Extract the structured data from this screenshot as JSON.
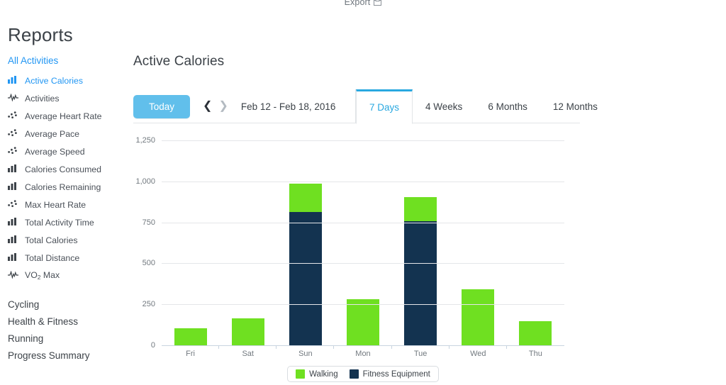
{
  "header": {
    "export_label": "Export",
    "export_icon": "export-icon",
    "page_title": "Reports"
  },
  "sidebar": {
    "group_label": "All Activities",
    "items": [
      {
        "label": "Active Calories",
        "icon": "bar-chart-icon",
        "active": true
      },
      {
        "label": "Activities",
        "icon": "pulse-line-icon",
        "active": false
      },
      {
        "label": "Average Heart Rate",
        "icon": "scatter-dots-icon",
        "active": false
      },
      {
        "label": "Average Pace",
        "icon": "scatter-dots-icon",
        "active": false
      },
      {
        "label": "Average Speed",
        "icon": "scatter-dots-icon",
        "active": false
      },
      {
        "label": "Calories Consumed",
        "icon": "bar-chart-icon",
        "active": false
      },
      {
        "label": "Calories Remaining",
        "icon": "bar-chart-icon",
        "active": false
      },
      {
        "label": "Max Heart Rate",
        "icon": "scatter-dots-icon",
        "active": false
      },
      {
        "label": "Total Activity Time",
        "icon": "bar-chart-icon",
        "active": false
      },
      {
        "label": "Total Calories",
        "icon": "bar-chart-icon",
        "active": false
      },
      {
        "label": "Total Distance",
        "icon": "bar-chart-icon",
        "active": false
      },
      {
        "label": "VO2 Max",
        "icon": "pulse-line-icon",
        "active": false,
        "subscript": "2",
        "label_pre": "VO",
        "label_post": " Max"
      }
    ],
    "sections": [
      {
        "label": "Cycling"
      },
      {
        "label": "Health & Fitness"
      },
      {
        "label": "Running"
      },
      {
        "label": "Progress Summary"
      }
    ]
  },
  "main": {
    "chart_title": "Active Calories",
    "controls": {
      "today_label": "Today",
      "prev_icon": "chevron-left-icon",
      "next_icon": "chevron-right-icon",
      "date_range": "Feb 12 - Feb 18, 2016"
    },
    "tabs": [
      {
        "label": "7 Days",
        "active": true
      },
      {
        "label": "4 Weeks",
        "active": false
      },
      {
        "label": "6 Months",
        "active": false
      },
      {
        "label": "12 Months",
        "active": false
      }
    ]
  },
  "chart_data": {
    "type": "bar",
    "stacked": true,
    "title": "Active Calories",
    "xlabel": "",
    "ylabel": "",
    "ylim": [
      0,
      1250
    ],
    "yticks": [
      0,
      250,
      500,
      750,
      1000,
      1250
    ],
    "ytick_labels": [
      "0",
      "250",
      "500",
      "750",
      "1,000",
      "1,250"
    ],
    "grid": true,
    "legend_position": "bottom",
    "categories": [
      "Fri",
      "Sat",
      "Sun",
      "Mon",
      "Tue",
      "Wed",
      "Thu"
    ],
    "series": [
      {
        "name": "Walking",
        "color": "#6fe021",
        "values": [
          105,
          165,
          170,
          280,
          150,
          340,
          145
        ]
      },
      {
        "name": "Fitness Equipment",
        "color": "#133350",
        "values": [
          0,
          0,
          815,
          0,
          755,
          0,
          0
        ]
      }
    ],
    "totals": [
      105,
      165,
      985,
      280,
      905,
      340,
      145
    ]
  },
  "colors": {
    "accent_blue": "#29a8e0",
    "link_blue": "#2196f3",
    "today_button": "#61bfeb",
    "walking_green": "#6fe021",
    "equipment_navy": "#133350",
    "grid": "#e4e6e9",
    "text": "#3c4248"
  }
}
